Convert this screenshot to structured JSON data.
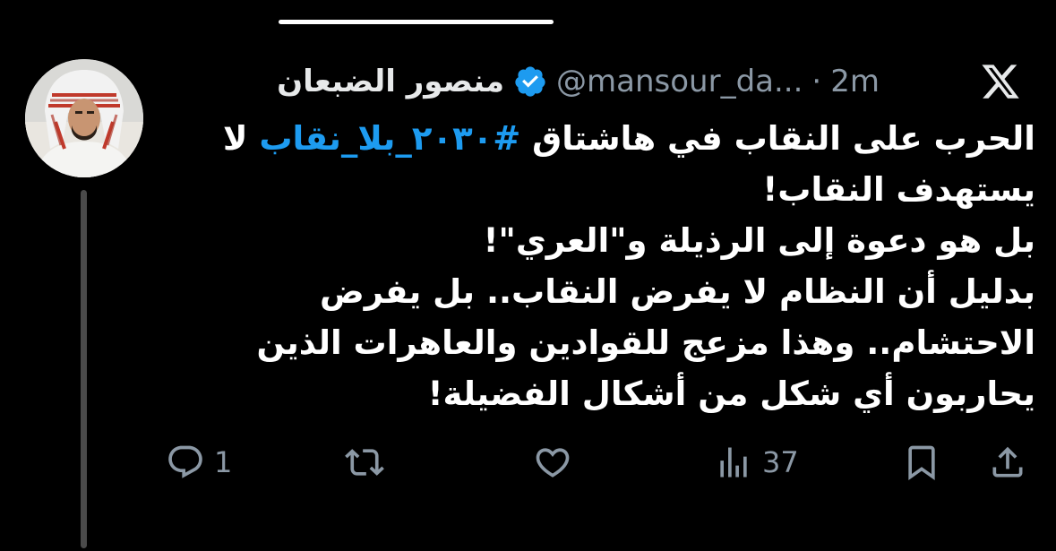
{
  "tweet": {
    "display_name": "منصور الضبعان",
    "handle": "@mansour_da...",
    "separator": "·",
    "time": "2m",
    "text_lines": {
      "l1_before": "الحرب على النقاب في هاشتاق ",
      "hashtag": "#٢٠٣٠_بلا_نقاب",
      "l1_after": " لا",
      "l2": "يستهدف النقاب!",
      "l3": "بل هو دعوة إلى الرذيلة و\"العري\"!",
      "l4": "بدليل أن النظام لا يفرض النقاب.. بل يفرض",
      "l5": "الاحتشام.. وهذا مزعج للقوادين والعاهرات الذين",
      "l6": "يحاربون أي شكل من أشكال الفضيلة!"
    }
  },
  "actions": {
    "reply_count": "1",
    "views_count": "37"
  },
  "icons": [
    "x-logo-icon",
    "verified-badge-icon",
    "reply-icon",
    "retweet-icon",
    "like-icon",
    "views-icon",
    "bookmark-icon",
    "share-icon"
  ],
  "colors": {
    "background": "#000000",
    "text": "#ffffff",
    "muted": "#8b98a5",
    "link": "#1d9bf0",
    "verified": "#1d9bf0"
  }
}
